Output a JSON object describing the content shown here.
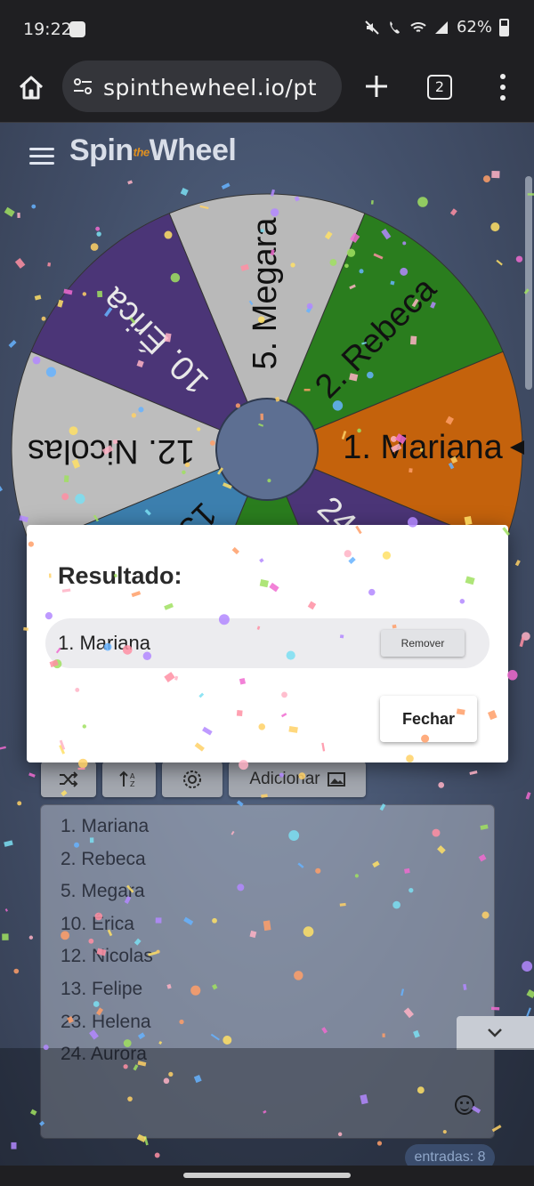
{
  "status_bar": {
    "time": "19:22",
    "battery": "62%",
    "icons": [
      "mute-icon",
      "volte-call-icon",
      "wifi-icon",
      "signal-icon",
      "battery-icon"
    ]
  },
  "browser": {
    "url": "spinthewheel.io/pt",
    "tab_count": "2"
  },
  "app": {
    "logo_main_1": "Spin",
    "logo_the": "the",
    "logo_main_2": "Wheel"
  },
  "wheel": {
    "segments": [
      {
        "label": "1. Mariana",
        "color": "#c4620c"
      },
      {
        "label": "2. Rebeca",
        "color": "#2a7d1e"
      },
      {
        "label": "5. Megara",
        "color": "#b9b9b9"
      },
      {
        "label": "10. Érica",
        "color": "#4b3577"
      },
      {
        "label": "12. Nicolas",
        "color": "#bdbdbd"
      },
      {
        "label": "13. Felipe",
        "color": "#3c7fae"
      },
      {
        "label": "23. Helena",
        "color": "#2a7d1e"
      },
      {
        "label": "24. Aurora",
        "color": "#4b3577"
      }
    ],
    "hub_color": "#5d6f92"
  },
  "controls": {
    "add_label": "Adicionar"
  },
  "entries": {
    "items": [
      "1. Mariana",
      "2. Rebeca",
      "5. Megara",
      "10. Érica",
      "12. Nicolas",
      "13. Felipe",
      "23. Helena",
      "24. Aurora"
    ],
    "count_label": "entradas: 8"
  },
  "modal": {
    "title": "Resultado:",
    "result": "1. Mariana",
    "remove_label": "Remover",
    "close_label": "Fechar"
  }
}
